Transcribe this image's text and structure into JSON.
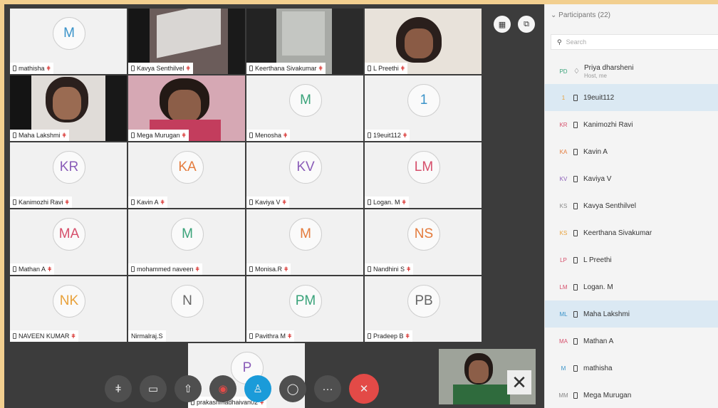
{
  "tiles": [
    {
      "id": "t1",
      "initials": "M",
      "name": "mathisha",
      "color": "#3a93c9"
    },
    {
      "id": "t2",
      "name": "Kavya Senthilvel"
    },
    {
      "id": "t3",
      "name": "Keerthana Sivakumar"
    },
    {
      "id": "t4",
      "name": "L Preethi"
    },
    {
      "id": "t5",
      "name": "Maha Lakshmi"
    },
    {
      "id": "t6",
      "name": "Mega Murugan"
    },
    {
      "id": "t7",
      "initials": "M",
      "name": "Menosha",
      "color": "#3aa37a"
    },
    {
      "id": "t8",
      "initials": "1",
      "name": "19euit112",
      "color": "#3a93c9"
    },
    {
      "id": "t9",
      "initials": "KR",
      "name": "Kanimozhi Ravi",
      "color": "#8a5cb8"
    },
    {
      "id": "t10",
      "initials": "KA",
      "name": "Kavin A",
      "color": "#e47b3c"
    },
    {
      "id": "t11",
      "initials": "KV",
      "name": "Kaviya V",
      "color": "#8a5cb8"
    },
    {
      "id": "t12",
      "initials": "LM",
      "name": "Logan. M",
      "color": "#d64f6b"
    },
    {
      "id": "t13",
      "initials": "MA",
      "name": "Mathan A",
      "color": "#d64f6b"
    },
    {
      "id": "t14",
      "initials": "M",
      "name": "mohammed naveen",
      "color": "#3aa37a"
    },
    {
      "id": "t15",
      "initials": "M",
      "name": "Monisa.R",
      "color": "#e47b3c"
    },
    {
      "id": "t16",
      "initials": "NS",
      "name": "Nandhini S",
      "color": "#e47b3c"
    },
    {
      "id": "t17",
      "initials": "NK",
      "name": "NAVEEN KUMAR",
      "color": "#e8a13a"
    },
    {
      "id": "t18",
      "initials": "N",
      "name": "Nirmalraj.S",
      "color": "#666666"
    },
    {
      "id": "t19",
      "initials": "PM",
      "name": "Pavithra M",
      "color": "#3aa37a"
    },
    {
      "id": "t20",
      "initials": "PB",
      "name": "Pradeep B",
      "color": "#666666"
    },
    {
      "id": "t21",
      "initials": "P",
      "name": "prakashmadhaivan02",
      "color": "#8a5cb8"
    }
  ],
  "controls": [
    "mute",
    "video",
    "share",
    "record",
    "participants",
    "chat",
    "more",
    "leave"
  ],
  "panel": {
    "title": "Participants (22)",
    "search_placeholder": "Search",
    "host": {
      "initials": "PD",
      "name": "Priya dharsheni",
      "sub": "Host, me",
      "color": "#3aa37a"
    },
    "rows": [
      {
        "initials": "1",
        "name": "19euit112",
        "color": "#e8a13a",
        "selected": true
      },
      {
        "initials": "KR",
        "name": "Kanimozhi Ravi",
        "color": "#d64f6b"
      },
      {
        "initials": "KA",
        "name": "Kavin A",
        "color": "#e47b3c"
      },
      {
        "initials": "KV",
        "name": "Kaviya V",
        "color": "#8a5cb8"
      },
      {
        "initials": "KS",
        "name": "Kavya Senthilvel",
        "color": "#888888"
      },
      {
        "initials": "KS",
        "name": "Keerthana Sivakumar",
        "color": "#e8a13a"
      },
      {
        "initials": "LP",
        "name": "L Preethi",
        "color": "#d64f6b"
      },
      {
        "initials": "LM",
        "name": "Logan. M",
        "color": "#d64f6b"
      },
      {
        "initials": "ML",
        "name": "Maha Lakshmi",
        "color": "#3a93c9",
        "selected": true
      },
      {
        "initials": "MA",
        "name": "Mathan A",
        "color": "#d64f6b"
      },
      {
        "initials": "M",
        "name": "mathisha",
        "color": "#3a93c9"
      },
      {
        "initials": "MM",
        "name": "Mega Murugan",
        "color": "#888888"
      }
    ]
  }
}
